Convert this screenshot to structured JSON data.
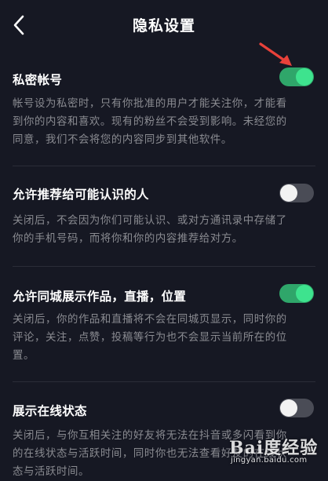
{
  "header": {
    "title": "隐私设置",
    "back_icon": "chevron-left-icon"
  },
  "annotation": {
    "arrow_color": "#e8413a"
  },
  "colors": {
    "background": "#161823",
    "toggle_on": "#2fa66a",
    "toggle_knob_on": "#3ee38e",
    "toggle_off": "#4a4c56",
    "desc_text": "#8a8b91"
  },
  "settings": [
    {
      "title": "私密帐号",
      "enabled": true,
      "desc_lines": [
        "帐号设为私密时，只有你批准的用户才能关注你，才能看",
        "到你的内容和喜欢。现有的粉丝不会受到影响。未经您的",
        "同意，我们不会将您的内容同步到其他软件。"
      ]
    },
    {
      "title": "允许推荐给可能认识的人",
      "enabled": false,
      "desc_lines": [
        "关闭后，不会因为你们可能认识、或对方通讯录中存储了",
        "你的手机号码，而将你和你的内容推荐给对方。"
      ]
    },
    {
      "title": "允许同城展示作品，直播，位置",
      "enabled": true,
      "desc_lines": [
        "关闭后，你的作品和直播将不会在同城页显示，同时你的",
        "评论，关注，点赞，投稿等行为也不会显示当前所在的位",
        "置。"
      ]
    },
    {
      "title": "展示在线状态",
      "enabled": false,
      "desc_lines": [
        "关闭后，与你互相关注的好友将无法在抖音或多闪看到你",
        "的在线状态与活跃时间，同时你也无法查看好友的在线状",
        "态与活跃时间。"
      ]
    }
  ],
  "watermark": {
    "logo_text": "Bai度经验",
    "url": "jingyan.baidu.com"
  }
}
